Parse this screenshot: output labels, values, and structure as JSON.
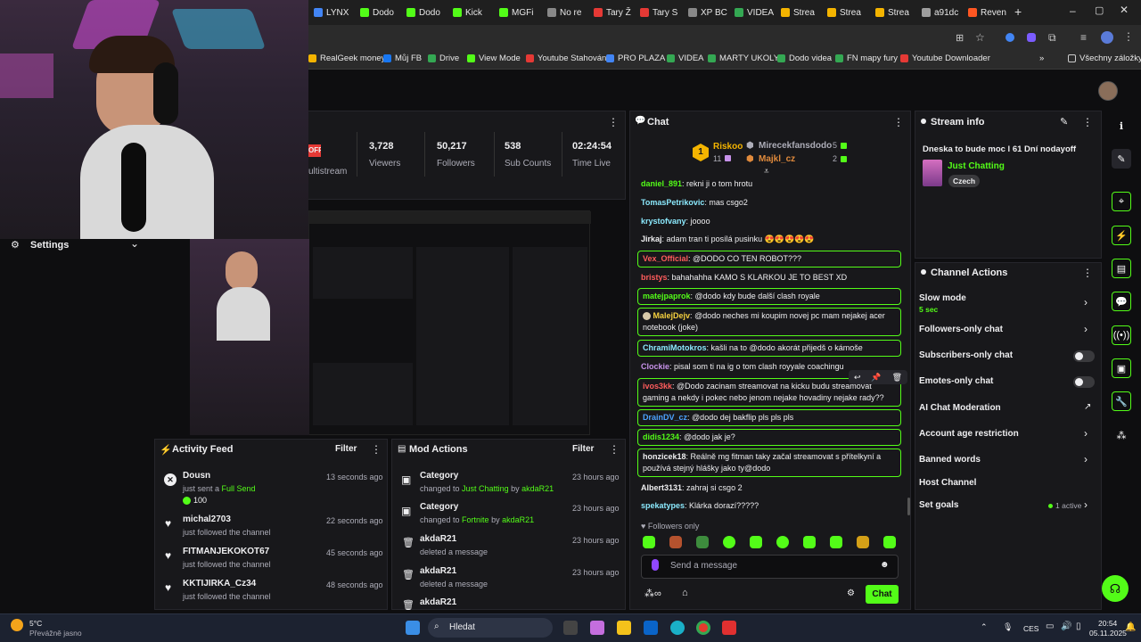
{
  "browser": {
    "tabs": [
      "LYNX",
      "Dodo",
      "Dodo",
      "Kick",
      "MGFi",
      "No re",
      "Tary Ž",
      "Tary S",
      "XP BC",
      "VIDEA",
      "Strea",
      "Strea",
      "Strea",
      "a91dc",
      "Reven"
    ],
    "tab_colors": [
      "#4285f4",
      "#53fc18",
      "#53fc18",
      "#53fc18",
      "#53fc18",
      "#888888",
      "#e53935",
      "#e53935",
      "#888888",
      "#34a853",
      "#f4b400",
      "#f4b400",
      "#f4b400",
      "#9e9e9e",
      "#ff5722"
    ],
    "bookmarks": [
      "RealGeek money",
      "Můj FB",
      "Drive",
      "View Mode",
      "Youtube Stahování",
      "PRO PLAZA",
      "VIDEA",
      "MARTY UKOLY",
      "Dodo videa",
      "FN mapy fury",
      "Youtube Downloader"
    ],
    "bookmark_colors": [
      "#f4b400",
      "#1877f2",
      "#34a853",
      "#53fc18",
      "#e53935",
      "#4285f4",
      "#34a853",
      "#34a853",
      "#34a853",
      "#34a853",
      "#e53935"
    ],
    "all_bookmarks": "Všechny záložky"
  },
  "dashboard": {
    "multistream_badge": "OFF",
    "multistream_label": "ultistream",
    "stats": [
      {
        "value": "3,728",
        "label": "Viewers"
      },
      {
        "value": "50,217",
        "label": "Followers"
      },
      {
        "value": "538",
        "label": "Sub Counts"
      },
      {
        "value": "02:24:54",
        "label": "Time Live"
      }
    ],
    "settings_label": "Settings"
  },
  "activity_feed": {
    "title": "Activity Feed",
    "filter": "Filter",
    "items": [
      {
        "user": "Dousn",
        "action_pre": "just sent a ",
        "action_hl": "Full Send",
        "extra": "100",
        "time": "13 seconds ago"
      },
      {
        "user": "michal2703",
        "action_pre": "just followed the channel",
        "action_hl": "",
        "extra": "",
        "time": "22 seconds ago"
      },
      {
        "user": "FITMANJEKOKOT67",
        "action_pre": "just followed the channel",
        "action_hl": "",
        "extra": "",
        "time": "45 seconds ago"
      },
      {
        "user": "KKTIJIRKA_Cz34",
        "action_pre": "just followed the channel",
        "action_hl": "",
        "extra": "",
        "time": "48 seconds ago"
      }
    ]
  },
  "mod_actions": {
    "title": "Mod Actions",
    "filter": "Filter",
    "items": [
      {
        "title": "Category",
        "pre": "changed to ",
        "hl1": "Just Chatting",
        "mid": " by ",
        "hl2": "akdaR21",
        "time": "23 hours ago"
      },
      {
        "title": "Category",
        "pre": "changed to ",
        "hl1": "Fortnite",
        "mid": " by ",
        "hl2": "akdaR21",
        "time": "23 hours ago"
      },
      {
        "title": "akdaR21",
        "pre": "deleted a message",
        "hl1": "",
        "mid": "",
        "hl2": "",
        "time": "23 hours ago"
      },
      {
        "title": "akdaR21",
        "pre": "deleted a message",
        "hl1": "",
        "mid": "",
        "hl2": "",
        "time": "23 hours ago"
      },
      {
        "title": "akdaR21",
        "pre": "",
        "hl1": "",
        "mid": "",
        "hl2": "",
        "time": ""
      }
    ]
  },
  "chat": {
    "title": "Chat",
    "leaderboard": {
      "rank": "1",
      "top_user": "Riskoo",
      "top_count": "11",
      "second_user": "Mirecekfansdodo",
      "second_count": "5",
      "third_user": "Majkl_cz",
      "third_count": "2"
    },
    "messages": [
      {
        "user": "daniel_891",
        "color": "#53fc18",
        "text": "rekni ji o tom hrotu",
        "hl": false
      },
      {
        "user": "TomasPetrikovic",
        "color": "#8be9fd",
        "text": "mas csgo2",
        "hl": false
      },
      {
        "user": "krystofvany",
        "color": "#8be9fd",
        "text": "joooo",
        "hl": false
      },
      {
        "user": "Jirkaj",
        "color": "#efeff1",
        "text": "adam tran ti posílá pusinku 😍😍😍😍😍",
        "hl": false
      },
      {
        "user": "Vex_Official",
        "color": "#ff5c5c",
        "text": "@DODO CO TEN ROBOT???",
        "hl": true
      },
      {
        "user": "bristys",
        "color": "#ff5c5c",
        "text": "bahahahha KAMO S KLARKOU JE TO BEST XD",
        "hl": false
      },
      {
        "user": "matejpaprok",
        "color": "#53fc18",
        "text": "@dodo kdy bude další clash royale",
        "hl": true
      },
      {
        "user": "MalejDejv",
        "color": "#f4d03f",
        "text": "@dodo neches mi koupim novej pc mam nejakej acer notebook (joke)",
        "hl": true
      },
      {
        "user": "ChramiMotokros",
        "color": "#8be9fd",
        "text": "kašli na to @dodo akorát přijedš o kámoše",
        "hl": true
      },
      {
        "user": "Clockie",
        "color": "#c792ea",
        "text": "pisal som ti na ig o tom clash royyale coachingu",
        "hl": false
      },
      {
        "user": "ivos3kk",
        "color": "#ff5c5c",
        "text": "@Dodo zacinam streamovat na kicku budu streamovat gaming a nekdy i pokec nebo jenom nejake hovadiny nejake rady??",
        "hl": true
      },
      {
        "user": "DrainDV_cz",
        "color": "#4da3ff",
        "text": "@dodo dej bakflip pls pls pls",
        "hl": true
      },
      {
        "user": "didis1234",
        "color": "#53fc18",
        "text": "@dodo jak je?",
        "hl": true
      },
      {
        "user": "honzicek18",
        "color": "#efeff1",
        "text": "Reálně mg fitman taky začal streamovat s přítelkyní a používá stejný hlášky jako ty@dodo",
        "hl": true
      },
      {
        "user": "Albert3131",
        "color": "#efeff1",
        "text": "zahraj si csgo 2",
        "hl": false
      },
      {
        "user": "spekatypes",
        "color": "#8be9fd",
        "text": "Klárka dorazí?????",
        "hl": false
      }
    ],
    "followers_only": "Followers only",
    "placeholder": "Send a message",
    "send": "Chat"
  },
  "stream_info": {
    "title": "Stream info",
    "stream_title": "Dneska to bude moc l 61 Dní nodayoff",
    "category": "Just Chatting",
    "tag": "Czech"
  },
  "channel_actions": {
    "title": "Channel Actions",
    "slow_mode": "Slow mode",
    "slow_value": "5 sec",
    "followers_only": "Followers-only chat",
    "subscribers_only": "Subscribers-only chat",
    "emotes_only": "Emotes-only chat",
    "ai_moderation": "AI Chat Moderation",
    "account_age": "Account age restriction",
    "banned_words": "Banned words",
    "host_channel": "Host Channel",
    "set_goals": "Set goals",
    "goals_active": "1 active"
  },
  "taskbar": {
    "temperature": "5°C",
    "weather": "Převážně jasno",
    "search": "Hledat",
    "language": "CES",
    "time": "20:54",
    "date": "05.11.2025"
  },
  "colors": {
    "accent": "#53fc18",
    "panel": "#18181b",
    "bg": "#0e0e10"
  }
}
